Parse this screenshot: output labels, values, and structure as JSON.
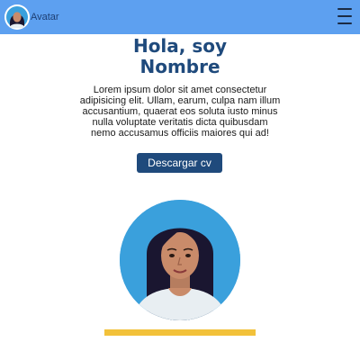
{
  "navbar": {
    "brand_label": "Avatar",
    "menu_icon": "hamburger-menu-icon",
    "avatar_icon": "avatar-icon"
  },
  "hero": {
    "title_line1": "Hola, soy",
    "title_line2": "Nombre",
    "description": "Lorem ipsum dolor sit amet consectetur adipisicing elit. Ullam, earum, culpa nam illum accusantium, quaerat eos soluta iusto minus nulla voluptate veritatis dicta quibusdam nemo accusamus officiis maiores qui ad!",
    "download_button": "Descargar cv"
  },
  "colors": {
    "navbar": "#5da0f0",
    "title": "#1f4a7c",
    "button": "#1f4a7c",
    "portrait_bg": "#3aa0dc",
    "accent_bar": "#f2c13a"
  }
}
